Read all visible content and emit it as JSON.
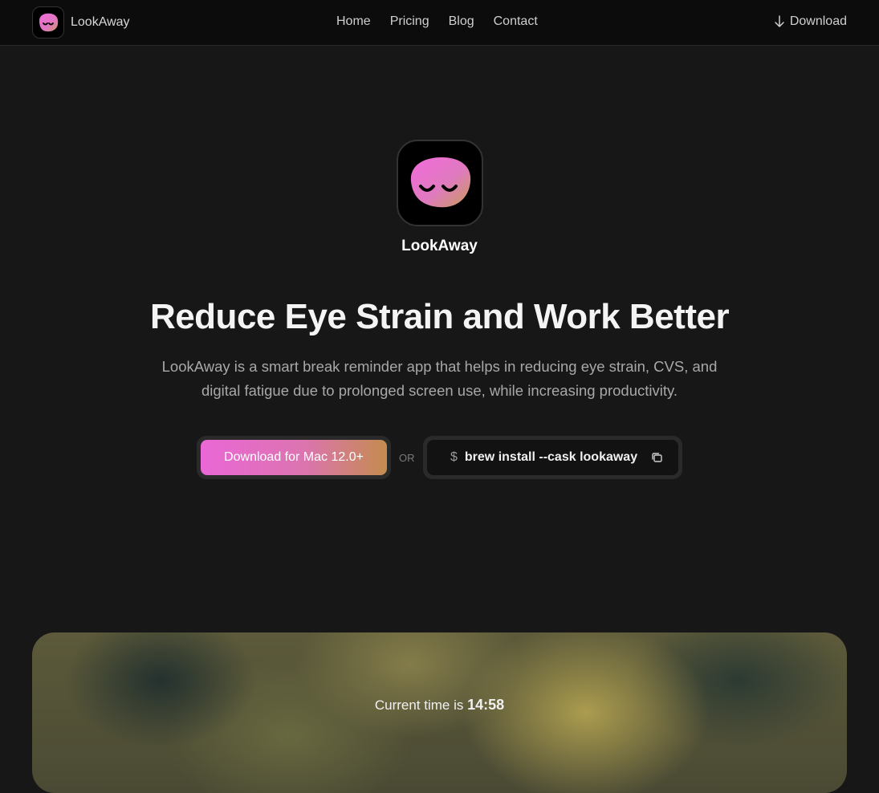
{
  "nav": {
    "brand": "LookAway",
    "links": [
      "Home",
      "Pricing",
      "Blog",
      "Contact"
    ],
    "download_label": "Download"
  },
  "hero": {
    "app_name": "LookAway",
    "headline": "Reduce Eye Strain and Work Better",
    "subtext": "LookAway is a smart break reminder app that helps in reducing eye strain, CVS, and digital fatigue due to prolonged screen use, while increasing productivity.",
    "cta_label": "Download for Mac 12.0+",
    "or_label": "OR",
    "brew_prompt": "$",
    "brew_command": "brew install --cask lookaway"
  },
  "preview": {
    "time_prefix": "Current time is",
    "time_value": "14:58"
  },
  "colors": {
    "accent_pink": "#ea67d6",
    "accent_gold": "#c48c4e",
    "background": "#171717"
  },
  "icons": {
    "nav_download": "arrow-down-icon",
    "copy": "copy-icon",
    "logo": "sleepy-face-logo"
  }
}
